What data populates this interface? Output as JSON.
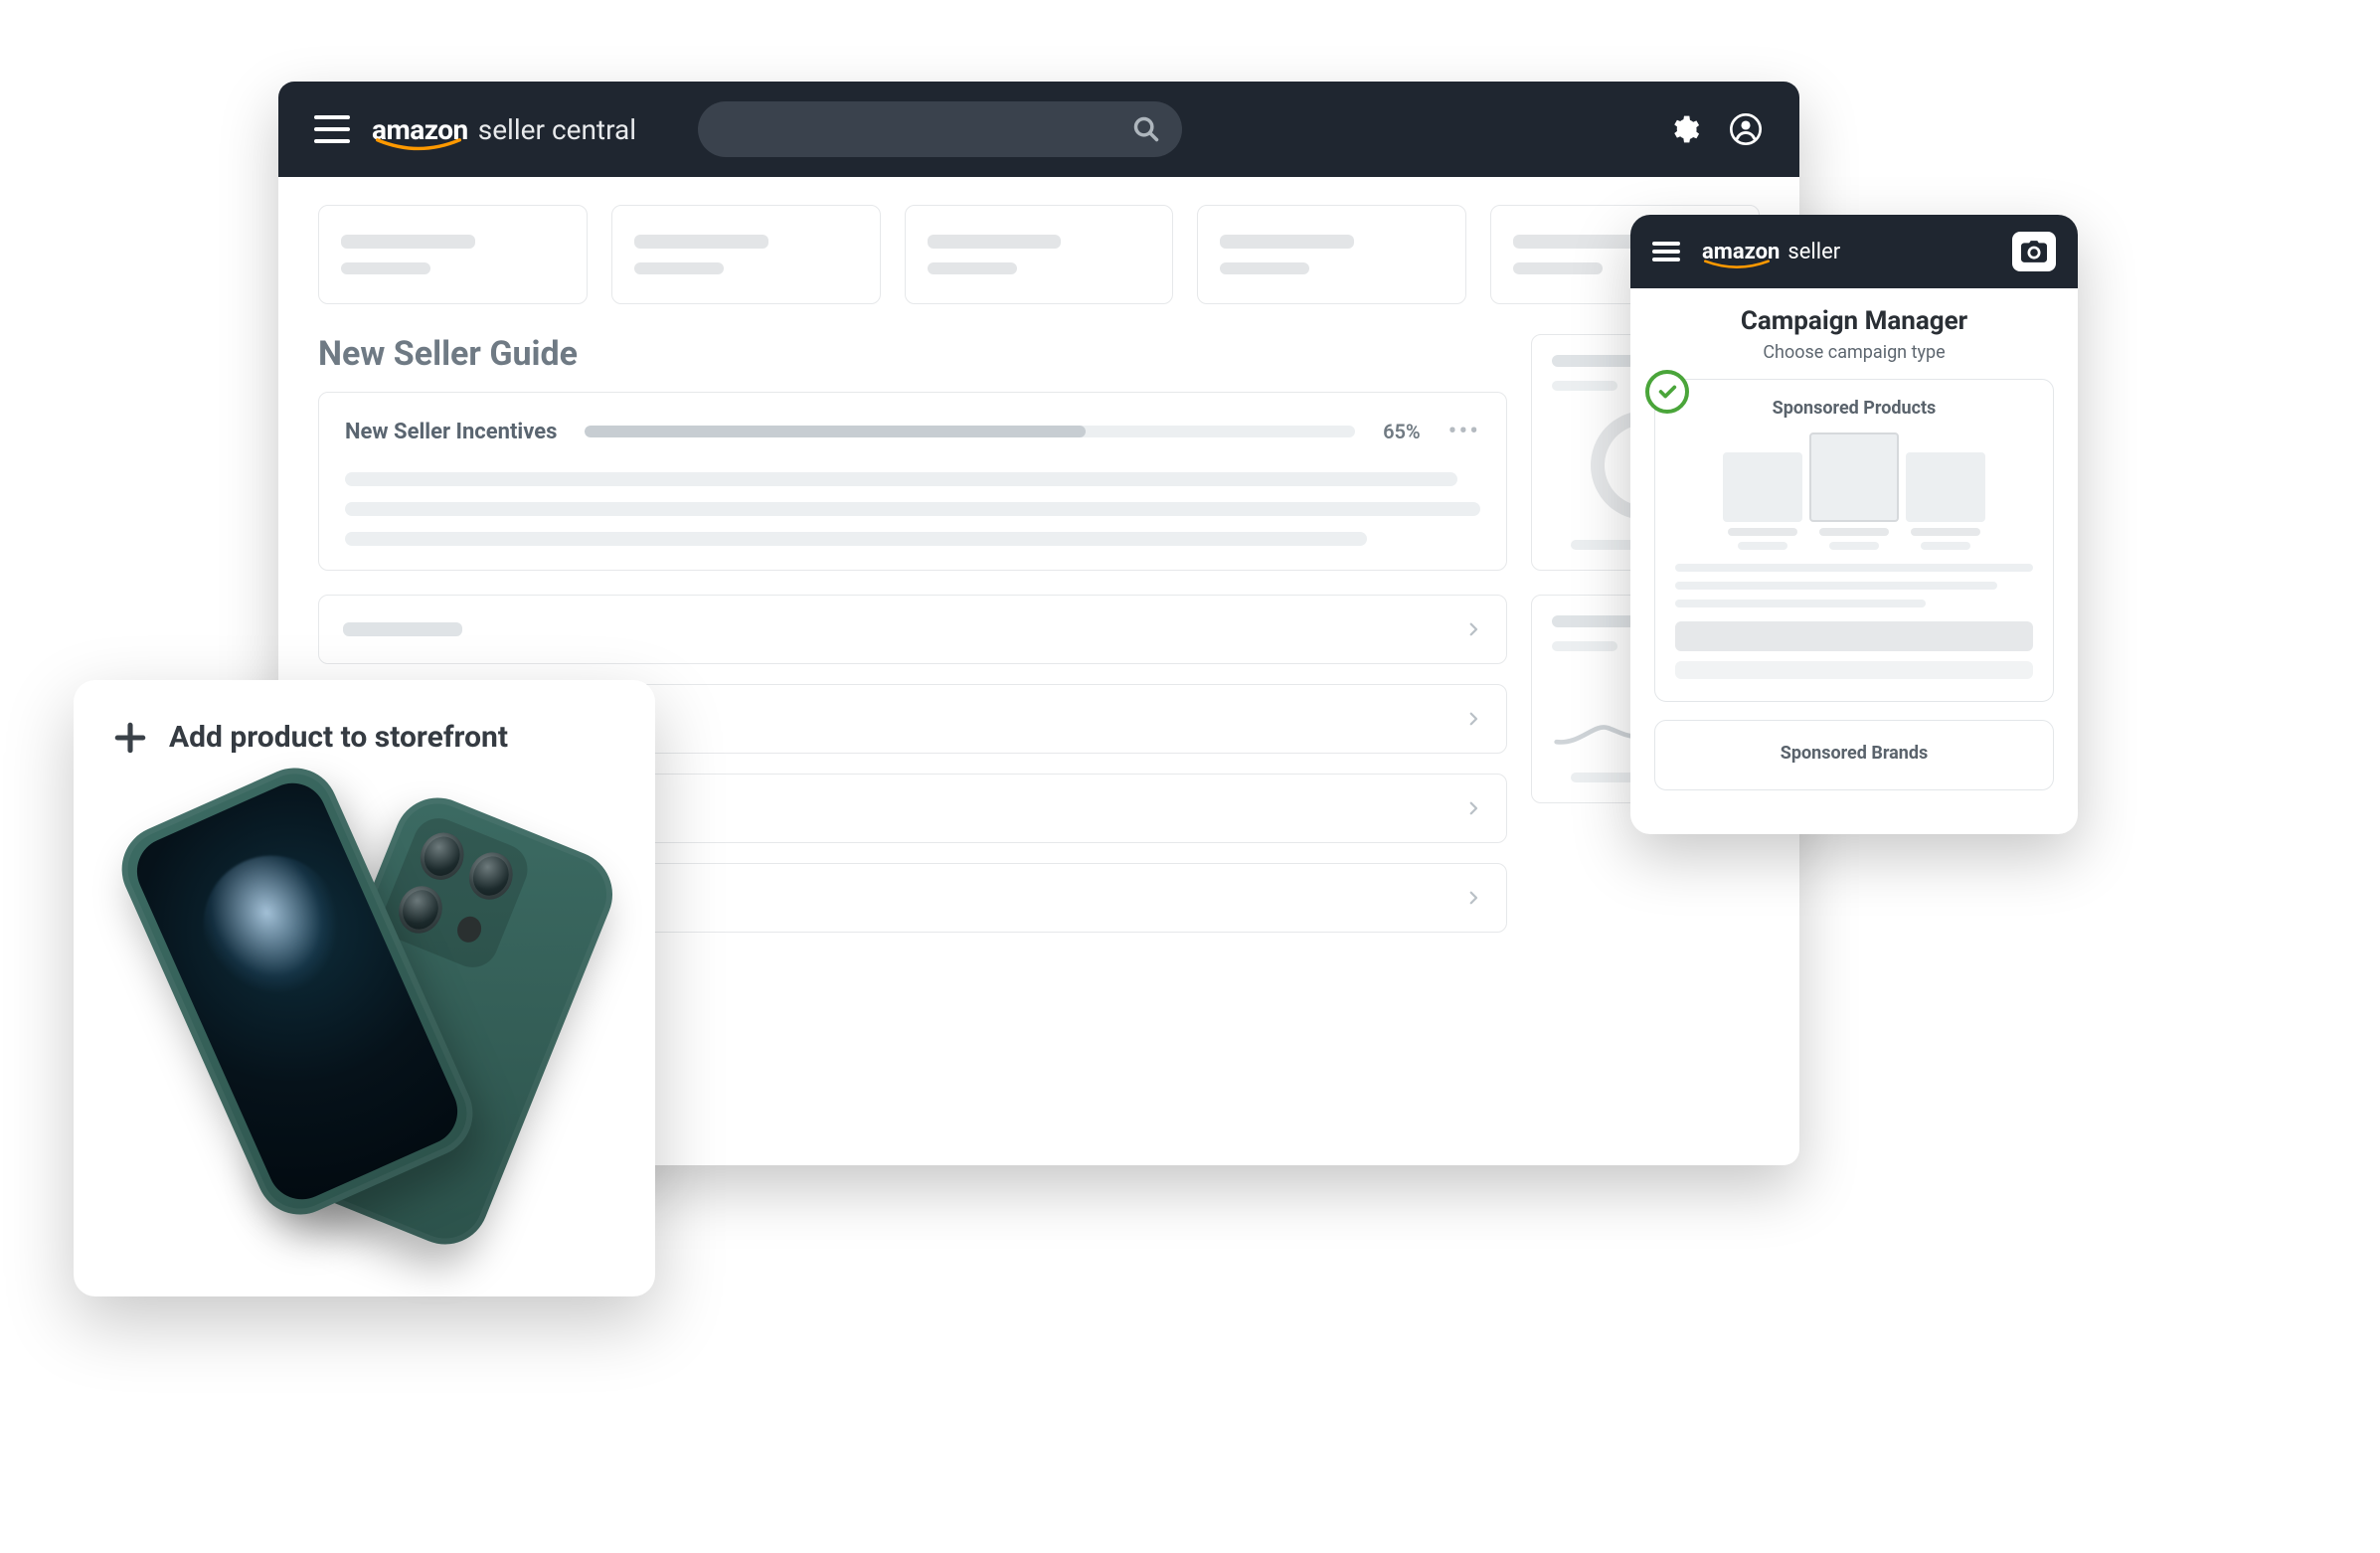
{
  "dashboard": {
    "brand_primary": "amazon",
    "brand_suffix": "seller central",
    "section_title": "New Seller Guide",
    "incentives_title": "New Seller Incentives",
    "progress_pct_label": "65%",
    "progress_pct_value": 65
  },
  "mobile": {
    "brand_primary": "amazon",
    "brand_suffix": "seller",
    "title": "Campaign Manager",
    "subtitle": "Choose campaign type",
    "card1_title": "Sponsored Products",
    "card2_title": "Sponsored Brands"
  },
  "add_card": {
    "title": "Add product to storefront"
  },
  "colors": {
    "topbar": "#1f2630",
    "check_green": "#4aa53a",
    "teal": "#2c524b"
  }
}
